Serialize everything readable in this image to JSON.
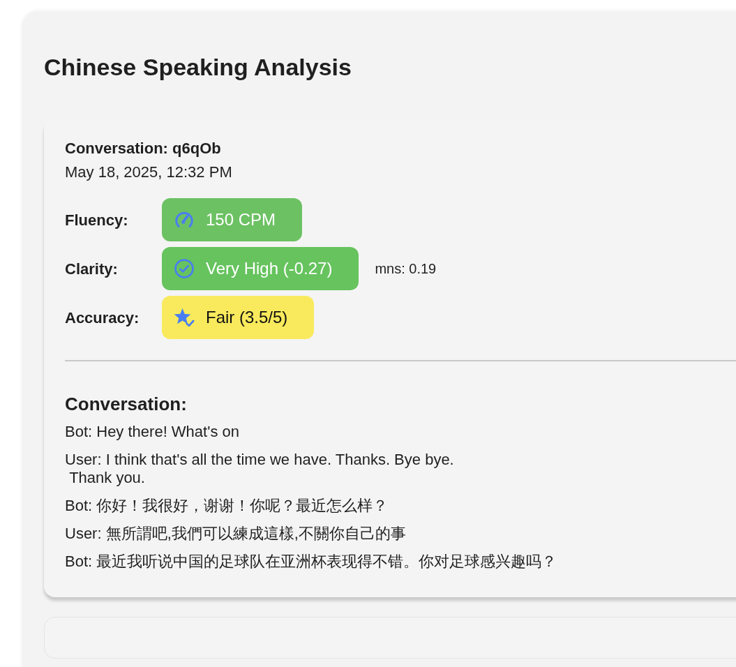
{
  "title": "Chinese Speaking Analysis",
  "conversation_card": {
    "heading": "Conversation: q6qOb",
    "date": "May 18, 2025, 12:32 PM",
    "metrics": [
      {
        "label": "Fluency:",
        "kind": "speed",
        "value": "150 CPM",
        "color": "#6cc163"
      },
      {
        "label": "Clarity:",
        "kind": "clarity",
        "value": "Very High (-0.27)",
        "color": "#66c35e",
        "note": "mns: 0.19"
      },
      {
        "label": "Accuracy:",
        "kind": "accuracy",
        "value": "Fair (3.5/5)",
        "color": "#f8ea5c"
      }
    ],
    "transcript_heading": "Conversation:",
    "messages": [
      "Bot: Hey there! What's on",
      "User: I think that's all the time we have. Thanks. Bye bye.\n Thank you.",
      "Bot: 你好！我很好，谢谢！你呢？最近怎么样？",
      "User: 無所謂吧,我們可以練成這樣,不關你自己的事",
      "Bot: 最近我听说中国的足球队在亚洲杯表现得不错。你对足球感兴趣吗？"
    ]
  }
}
